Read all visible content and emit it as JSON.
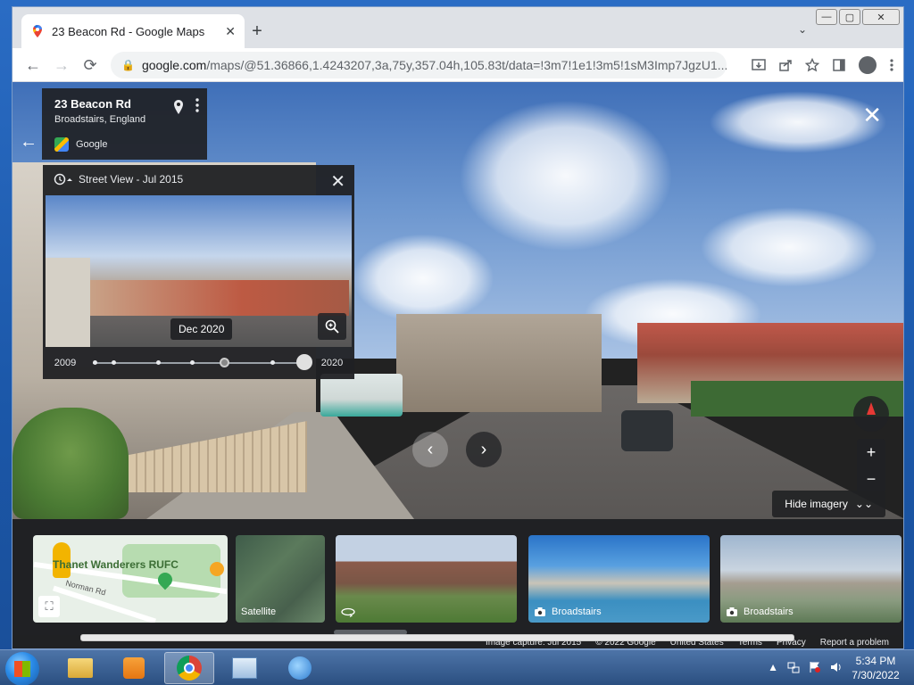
{
  "browser": {
    "tab_title": "23 Beacon Rd - Google Maps",
    "tab_close": "✕",
    "new_tab": "+",
    "tab_search": "⌄",
    "url_host": "google.com",
    "url_path": "/maps/@51.36866,1.4243207,3a,75y,357.04h,105.83t/data=!3m7!1e1!3m5!1sM3Imp7JgzU1...",
    "back": "←",
    "forward": "→",
    "reload": "⟳",
    "lock": "🔒",
    "window_minimize": "—",
    "window_maximize": "▢",
    "window_close": "✕"
  },
  "streetview": {
    "place_name": "23 Beacon Rd",
    "place_locality": "Broadstairs, England",
    "source": "Google",
    "back_arrow": "←",
    "close": "✕",
    "timeline": {
      "header": "Street View - Jul 2015",
      "close": "✕",
      "tooltip": "Dec 2020",
      "start_year": "2009",
      "end_year": "2020",
      "selected_fraction": 1.0
    },
    "nav_prev": "‹",
    "nav_next": "›",
    "zoom_in": "+",
    "zoom_out": "−",
    "hide_imagery": "Hide imagery",
    "hide_icon": "⌄⌄"
  },
  "strip": {
    "map_label": "Thanet Wanderers RUFC",
    "map_road": "Norman Rd",
    "satellite_label": "Satellite",
    "beach1_label": "Broadstairs",
    "beach2_label": "Broadstairs"
  },
  "footer": {
    "image_capture": "Image capture: Jul 2015",
    "copyright": "© 2022 Google",
    "country": "United States",
    "terms": "Terms",
    "privacy": "Privacy",
    "report": "Report a problem"
  },
  "taskbar": {
    "time": "5:34 PM",
    "date": "7/30/2022"
  }
}
